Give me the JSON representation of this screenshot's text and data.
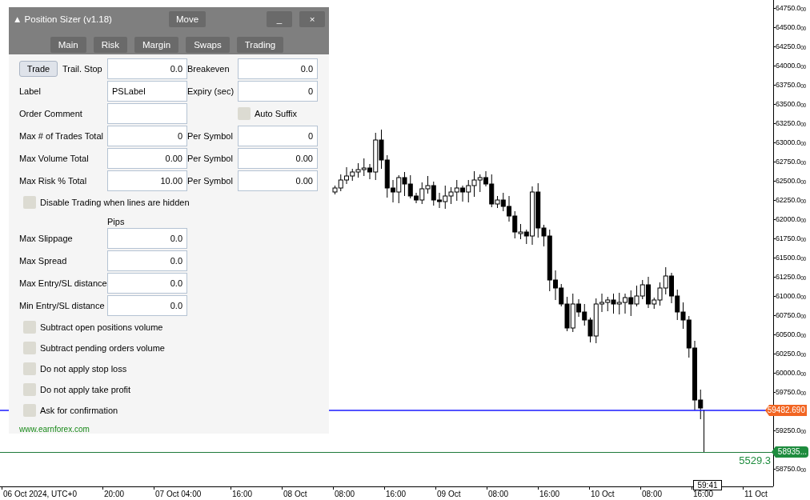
{
  "chart": {
    "price_labels": [
      "64750.0$_{00}$",
      "64500.0$_{00}$",
      "64250.0$_{00}$",
      "64000.0$_{00}$",
      "63750.0$_{00}$",
      "63500.0$_{00}$",
      "63250.0$_{00}$",
      "63000.0$_{00}$",
      "62750.0$_{00}$",
      "62500.0$_{00}$",
      "62250.0$_{00}$",
      "62000.0$_{00}$",
      "61750.0$_{00}$",
      "61500.0$_{00}$",
      "61250.0$_{00}$",
      "61000.0$_{00}$",
      "60750.0$_{00}$",
      "60500.0$_{00}$",
      "60250.0$_{00}$",
      "60000.0$_{00}$",
      "59750.0$_{00}$"
    ],
    "lower_price_labels": [
      "59250.0$_{00}$",
      "58750.0$_{00}$"
    ],
    "bid_tag": "59482.690",
    "target_tag": "58935...",
    "target_value": "5529.3",
    "time_tag": "59:41",
    "time_labels": [
      "06 Oct 2024, UTC+0",
      "20:00",
      "07 Oct 04:00",
      "16:00",
      "08 Oct",
      "08:00",
      "16:00",
      "09 Oct",
      "08:00",
      "16:00",
      "10 Oct",
      "08:00",
      "16:00",
      "11 Oct"
    ]
  },
  "panel": {
    "title": "▲ Position Sizer (v1.18)",
    "move_button": "Move",
    "minimize_button": "_",
    "close_button": "×",
    "tabs": [
      "Main",
      "Risk",
      "Margin",
      "Swaps",
      "Trading"
    ],
    "trade_button": "Trade",
    "trail_stop": {
      "label": "Trail. Stop",
      "value": "0.0"
    },
    "breakeven": {
      "label": "Breakeven",
      "value": "0.0"
    },
    "label_field": {
      "label": "Label",
      "value": "PSLabel"
    },
    "expiry": {
      "label": "Expiry (sec)",
      "value": "0"
    },
    "order_comment": {
      "label": "Order Comment"
    },
    "auto_suffix": {
      "label": "Auto Suffix",
      "checked": false
    },
    "limits": [
      {
        "label": "Max # of Trades Total",
        "value": "0",
        "per_symbol_label": "Per Symbol",
        "per_symbol_value": "0"
      },
      {
        "label": "Max Volume Total",
        "value": "0.00",
        "per_symbol_label": "Per Symbol",
        "per_symbol_value": "0.00"
      },
      {
        "label": "Max Risk % Total",
        "value": "10.00",
        "per_symbol_label": "Per Symbol",
        "per_symbol_value": "0.00"
      }
    ],
    "disable_trading": {
      "label": "Disable Trading when lines are hidden",
      "checked": false
    },
    "pips_heading": "Pips",
    "pip_settings": [
      {
        "label": "Max Slippage",
        "value": "0.0"
      },
      {
        "label": "Max Spread",
        "value": "0.0"
      },
      {
        "label": "Max Entry/SL distance",
        "value": "0.0"
      },
      {
        "label": "Min Entry/SL distance",
        "value": "0.0"
      }
    ],
    "options": [
      {
        "label": "Subtract open positions volume",
        "checked": false
      },
      {
        "label": "Subtract pending orders volume",
        "checked": false
      },
      {
        "label": "Do not apply stop loss",
        "checked": false
      },
      {
        "label": "Do not apply take profit",
        "checked": false
      },
      {
        "label": "Ask for confirmation",
        "checked": false
      }
    ],
    "footer_link": "www.earnforex.com"
  }
}
